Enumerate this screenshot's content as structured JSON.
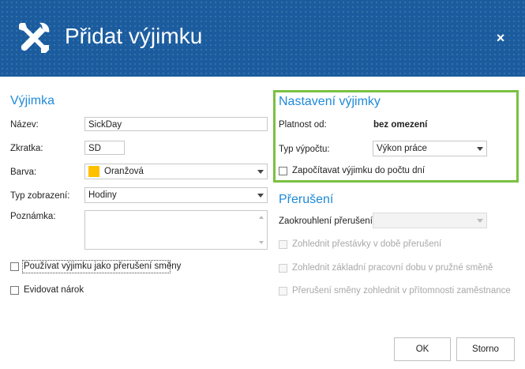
{
  "header": {
    "title": "Přidat výjimku",
    "close_label": "×",
    "icon": "tools-icon"
  },
  "left": {
    "section_title": "Výjimka",
    "name_label": "Název:",
    "name_value": "SickDay",
    "abbr_label": "Zkratka:",
    "abbr_value": "SD",
    "color_label": "Barva:",
    "color_value": "Oranžová",
    "color_swatch": "#ffc000",
    "display_label": "Typ zobrazení:",
    "display_value": "Hodiny",
    "note_label": "Poznámka:",
    "use_as_break_label": "Používat výjimku jako přerušení směny",
    "track_claim_label": "Evidovat nárok"
  },
  "right": {
    "section_title": "Nastavení výjimky",
    "validity_label": "Platnost od:",
    "validity_value": "bez omezení",
    "calc_label": "Typ výpočtu:",
    "calc_value": "Výkon práce",
    "count_days_label": "Započítavat výjimku do počtu dní",
    "break_title": "Přerušení",
    "rounding_label": "Zaokrouhlení přerušení:",
    "opt1_label": "Zohlednit přestávky v době přerušení",
    "opt2_label": "Zohlednit základní pracovní dobu v pružné směně",
    "opt3_label": "Přerušení směny zohlednit v přítomnosti zaměstnance"
  },
  "footer": {
    "ok_label": "OK",
    "cancel_label": "Storno"
  },
  "colors": {
    "header_bg": "#1a5c9e",
    "section_title": "#1f8ad8",
    "highlight": "#7ac143"
  }
}
